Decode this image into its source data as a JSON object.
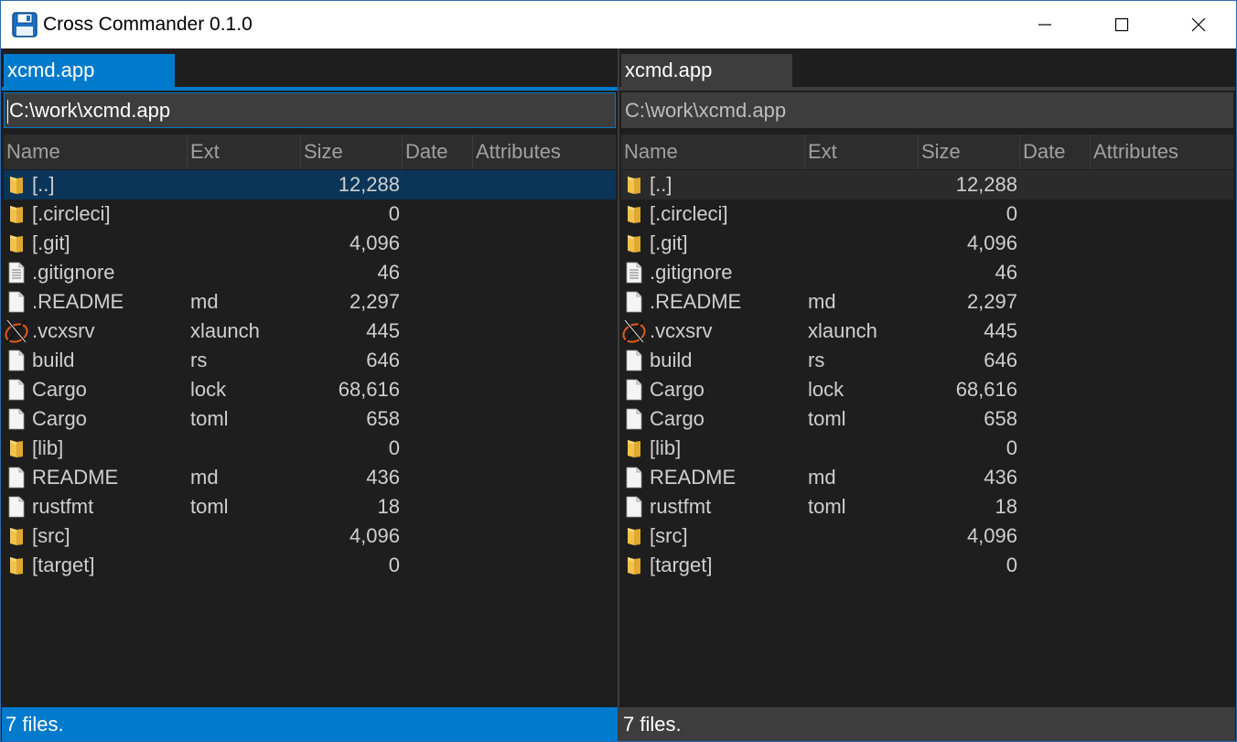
{
  "window": {
    "title": "Cross Commander 0.1.0",
    "app_icon": "floppy-disk-icon",
    "controls": [
      "minimize-icon",
      "maximize-icon",
      "close-icon"
    ]
  },
  "colors": {
    "accent": "#007acc",
    "background": "#1e1e1e",
    "inactive": "#3d3d3d",
    "folder": "#f2c14e",
    "selected_row_active": "#0a3558"
  },
  "columns": {
    "name": "Name",
    "ext": "Ext",
    "size": "Size",
    "date": "Date",
    "attributes": "Attributes"
  },
  "left_panel": {
    "active": true,
    "tab": "xcmd.app",
    "path": "C:\\work\\xcmd.app",
    "status": "7 files."
  },
  "right_panel": {
    "active": false,
    "tab": "xcmd.app",
    "path": "C:\\work\\xcmd.app",
    "status": "7 files."
  },
  "files": [
    {
      "name": "[..]",
      "ext": "",
      "size": "12,288",
      "icon": "folder-icon",
      "selected": true
    },
    {
      "name": "[.circleci]",
      "ext": "",
      "size": "0",
      "icon": "folder-icon"
    },
    {
      "name": "[.git]",
      "ext": "",
      "size": "4,096",
      "icon": "folder-icon"
    },
    {
      "name": ".gitignore",
      "ext": "",
      "size": "46",
      "icon": "text-file-icon"
    },
    {
      "name": ".README",
      "ext": "md",
      "size": "2,297",
      "icon": "file-icon"
    },
    {
      "name": ".vcxsrv",
      "ext": "xlaunch",
      "size": "445",
      "icon": "xlaunch-icon"
    },
    {
      "name": "build",
      "ext": "rs",
      "size": "646",
      "icon": "file-icon"
    },
    {
      "name": "Cargo",
      "ext": "lock",
      "size": "68,616",
      "icon": "file-icon"
    },
    {
      "name": "Cargo",
      "ext": "toml",
      "size": "658",
      "icon": "file-icon"
    },
    {
      "name": "[lib]",
      "ext": "",
      "size": "0",
      "icon": "folder-icon"
    },
    {
      "name": "README",
      "ext": "md",
      "size": "436",
      "icon": "file-icon"
    },
    {
      "name": "rustfmt",
      "ext": "toml",
      "size": "18",
      "icon": "file-icon"
    },
    {
      "name": "[src]",
      "ext": "",
      "size": "4,096",
      "icon": "folder-icon"
    },
    {
      "name": "[target]",
      "ext": "",
      "size": "0",
      "icon": "folder-icon"
    }
  ]
}
